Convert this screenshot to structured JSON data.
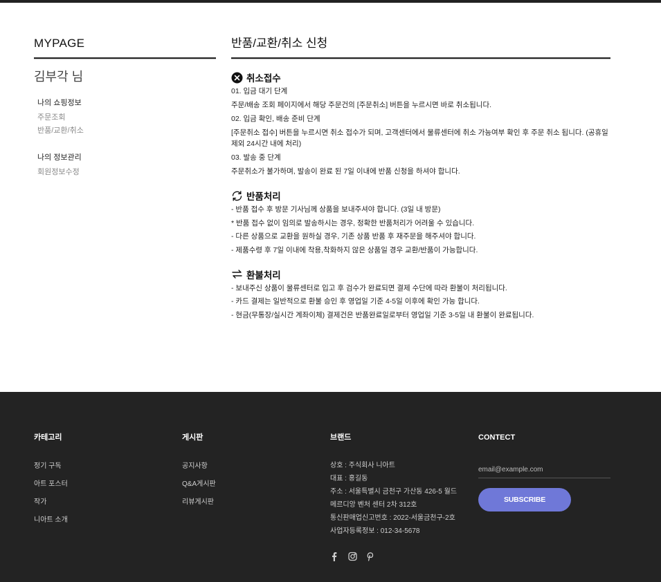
{
  "sidebar": {
    "title": "MYPAGE",
    "user_name": "김부각 님",
    "groups": [
      {
        "head": "나의 쇼핑정보",
        "links": [
          "주문조회",
          "반품/교환/취소"
        ]
      },
      {
        "head": "나의 정보관리",
        "links": [
          "회원정보수정"
        ]
      }
    ]
  },
  "main": {
    "title": "반품/교환/취소 신청",
    "cancel": {
      "heading": "취소접수",
      "lines": [
        "01. 입금 대기 단계",
        "주문/배송 조회 페이지에서 해당 주문건의 [주문취소] 버튼을 누르시면 바로 취소됩니다.",
        "02. 입금 확인, 배송 준비 단계",
        "[주문취소 접수] 버튼을 누르시면 취소 접수가 되며, 고객센터에서 물류센터에 취소 가능여부 확인 후 주문 취소 됩니다. (공휴일 제외 24시간 내에 처리)",
        "03. 발송 중 단계",
        "주문취소가 불가하며, 발송이 완료 된 7일 이내에 반품 신청을 하셔야 합니다."
      ]
    },
    "return": {
      "heading": "반품처리",
      "lines": [
        "- 반품 접수 후 방문 기사님께 상품을 보내주셔야 합니다. (3일 내 방문)",
        "* 반품 접수 없이 임의로 발송하시는 경우, 정확한 반품처리가 어려울 수 있습니다.",
        "- 다른 상품으로 교환을 원하실 경우, 기존 상품 반품 후 재주문을 해주셔야 합니다.",
        "- 제품수령 후 7일 이내에 착용,착화하지 않은 상품일 경우 교환/반품이 가능합니다."
      ]
    },
    "refund": {
      "heading": "환불처리",
      "lines": [
        "- 보내주신 상품이 물류센터로 입고 후 검수가 완료되면 결제 수단에 따라 환불이 처리됩니다.",
        "- 카드 결제는 일반적으로 환불 승인 후 영업일 기준 4-5일 이후에 확인 가능 합니다.",
        "- 현금(무통장/실시간 계좌이체) 결제건은 반품완료일로부터 영업일 기준 3-5일 내 환불이 완료됩니다."
      ]
    }
  },
  "footer": {
    "category": {
      "title": "카테고리",
      "links": [
        "정기 구독",
        "아트 포스터",
        "작가",
        "니아트 소개"
      ]
    },
    "board": {
      "title": "게시판",
      "links": [
        "공지사항",
        "Q&A게시판",
        "리뷰게시판"
      ]
    },
    "brand": {
      "title": "브랜드",
      "lines": [
        "상호 : 주식회사 니아트",
        "대표 : 홍길동",
        "주소 : 서울특별시 금천구 가산동 426-5 월드",
        "메르디앙 벤처 센터 2차 312호",
        "통신판매업신고번호 : 2022-서울금천구-2호",
        "사업자등록정보 : 012-34-5678"
      ],
      "social_icons": [
        "facebook-icon",
        "instagram-icon",
        "pinterest-icon"
      ]
    },
    "contact": {
      "title": "CONTECT",
      "email_placeholder": "email@example.com",
      "subscribe_label": "SUBSCRIBE"
    }
  },
  "colors": {
    "footer_bg": "#232323",
    "subscribe_bg": "#6f78d8",
    "topbar": "#222222"
  }
}
